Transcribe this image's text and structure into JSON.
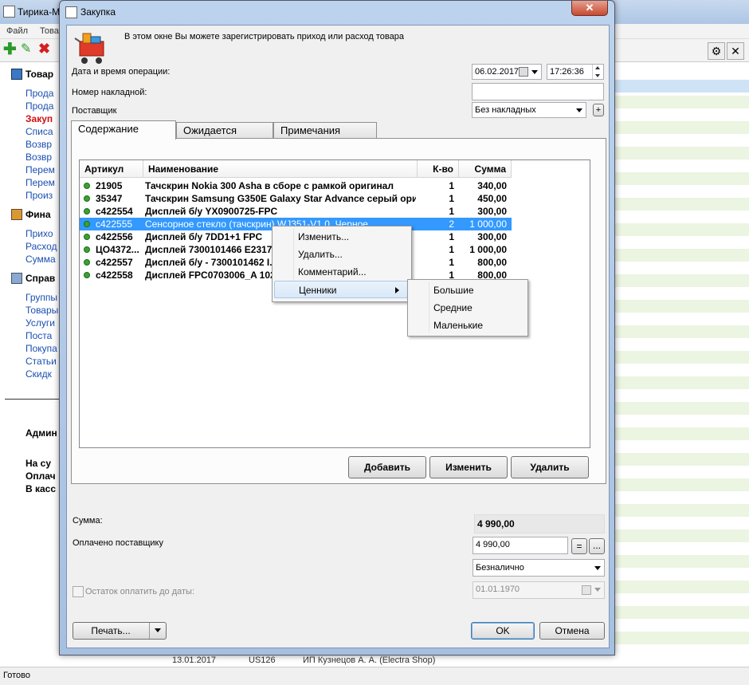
{
  "background": {
    "title": "Тирика-М",
    "menu": [
      "Файл",
      "Това"
    ],
    "nav": {
      "sec1": "Товар",
      "items1": [
        "Прода",
        "Прода",
        "Закуп",
        "Списа",
        "Возвр",
        "Возвр",
        "Перем",
        "Перем",
        "Произ"
      ],
      "sec2": "Фина",
      "items2": [
        "Прихо",
        "Расход",
        "Сумма"
      ],
      "sec3": "Справ",
      "items3": [
        "Группы",
        "Товары",
        "Услуги",
        "Поста",
        "Покупа",
        "Статьи",
        "Скидк"
      ],
      "admin": "Админ",
      "na_su": "На су",
      "oplach": "Оплач",
      "v_kas": "В касс"
    },
    "bottom_row": {
      "date": "13.01.2017",
      "code": "US126",
      "name": "ИП Кузнецов А. А. (Electra Shop)"
    },
    "status": "Готово"
  },
  "dialog": {
    "title": "Закупка",
    "close": "✕",
    "info": "В этом окне Вы можете зарегистрировать приход или расход товара",
    "labels": {
      "datetime": "Дата и время операции:",
      "invoice": "Номер накладной:",
      "supplier": "Поставщик",
      "sum": "Сумма:",
      "paid": "Оплачено поставщику",
      "remaining": "Остаток оплатить до даты:"
    },
    "date": "06.02.2017",
    "time": "17:26:36",
    "invoice_value": "",
    "supplier_value": "Без накладных",
    "plus": "+",
    "tabs": [
      "Содержание",
      "Ожидается",
      "Примечания"
    ],
    "grid": {
      "headers": [
        "Артикул",
        "Наименование",
        "К-во",
        "Сумма"
      ],
      "rows": [
        {
          "sku": "21905",
          "name": "Тачскрин Nokia 300 Asha в сборе с рамкой оригинал",
          "qty": "1",
          "sum": "340,00"
        },
        {
          "sku": "35347",
          "name": "Тачскрин Samsung G350E Galaxy Star Advance серый ори...",
          "qty": "1",
          "sum": "450,00"
        },
        {
          "sku": "c422554",
          "name": "Дисплей б/у YX0900725-FPC",
          "qty": "1",
          "sum": "300,00"
        },
        {
          "sku": "c422555",
          "name": "Сенсорное стекло (тачскрин) WJ351-V1.0, Черное",
          "qty": "2",
          "sum": "1 000,00"
        },
        {
          "sku": "c422556",
          "name": "Дисплей б/у 7DD1+1 FPC",
          "qty": "1",
          "sum": "300,00"
        },
        {
          "sku": "ЦО4372...",
          "name": "Дисплей 7300101466 E2317...",
          "qty": "1",
          "sum": "1 000,00"
        },
        {
          "sku": "c422557",
          "name": "Дисплей б/у - 7300101462 I...",
          "qty": "1",
          "sum": "800,00"
        },
        {
          "sku": "c422558",
          "name": "Дисплей FPC0703006_A 102...",
          "qty": "1",
          "sum": "800,00"
        }
      ]
    },
    "context_menu": [
      "Изменить...",
      "Удалить...",
      "Комментарий...",
      "Ценники"
    ],
    "submenu": [
      "Большие",
      "Средние",
      "Маленькие"
    ],
    "buttons": {
      "add": "Добавить",
      "edit": "Изменить",
      "delete": "Удалить",
      "print": "Печать...",
      "ok": "OK",
      "cancel": "Отмена",
      "eq": "=",
      "dots": "..."
    },
    "sum_value": "4 990,00",
    "paid_value": "4 990,00",
    "payment_type": "Безналично",
    "remaining_date": "01.01.1970"
  }
}
